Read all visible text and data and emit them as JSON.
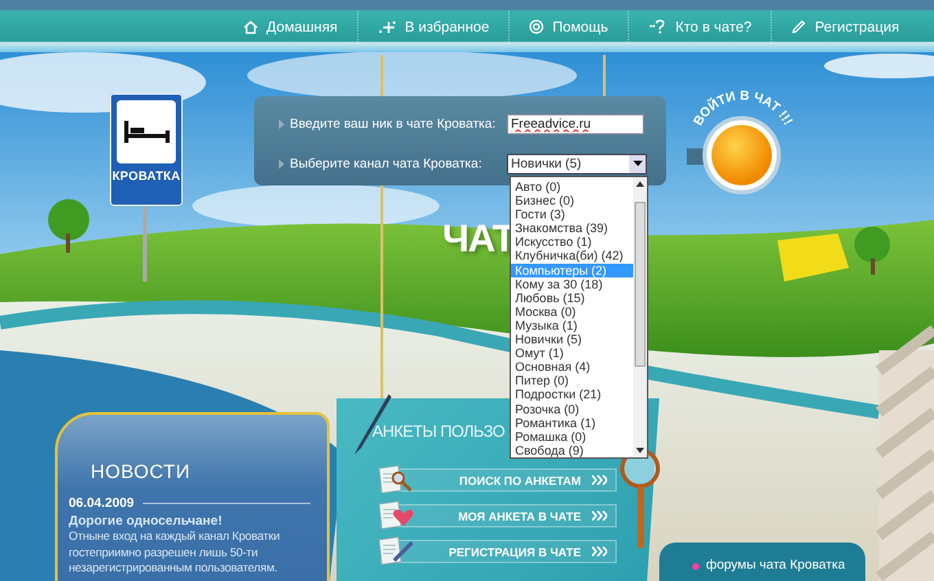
{
  "nav": [
    {
      "kind": "home",
      "label": "Домашняя"
    },
    {
      "kind": "favorite",
      "label": "В избранное"
    },
    {
      "kind": "help",
      "label": "Помощь"
    },
    {
      "kind": "who",
      "label": "Кто в чате?"
    },
    {
      "kind": "register",
      "label": "Регистрация"
    }
  ],
  "sign": {
    "label": "КРОВАТКА"
  },
  "login": {
    "nick_label": "Введите ваш ник в чате Кроватка:",
    "nick_value": "Freeadvice.ru",
    "channel_label": "Выберите канал чата Кроватка:",
    "channel_value": "Новички (5)",
    "enter_label": "ВОЙТИ В ЧАТ !!!"
  },
  "channel_list": [
    {
      "label": "Авто (0)",
      "selected": false
    },
    {
      "label": "Бизнес (0)",
      "selected": false
    },
    {
      "label": "Гости (3)",
      "selected": false
    },
    {
      "label": "Знакомства (39)",
      "selected": false
    },
    {
      "label": "Искусство (1)",
      "selected": false
    },
    {
      "label": "Клубничка(би) (42)",
      "selected": false
    },
    {
      "label": "Компьютеры (2)",
      "selected": true
    },
    {
      "label": "Кому за 30 (18)",
      "selected": false
    },
    {
      "label": "Любовь (15)",
      "selected": false
    },
    {
      "label": "Москва (0)",
      "selected": false
    },
    {
      "label": "Музыка (1)",
      "selected": false
    },
    {
      "label": "Новички (5)",
      "selected": false
    },
    {
      "label": "Омут (1)",
      "selected": false
    },
    {
      "label": "Основная (4)",
      "selected": false
    },
    {
      "label": "Питер (0)",
      "selected": false
    },
    {
      "label": "Подростки (21)",
      "selected": false
    },
    {
      "label": "Розочка (0)",
      "selected": false
    },
    {
      "label": "Романтика (1)",
      "selected": false
    },
    {
      "label": "Ромашка (0)",
      "selected": false
    },
    {
      "label": "Свобода (9)",
      "selected": false
    }
  ],
  "hero_title": "ЧАТ",
  "news": {
    "title": "НОВОСТИ",
    "date": "06.04.2009",
    "headline": "Дорогие односельчане!",
    "text": "Отныне вход на каждый канал Кроватки гостеприимно разрешен лишь 50-ти незарегистрированным пользователям."
  },
  "profiles": {
    "title": "АНКЕТЫ ПОЛЬЗО",
    "buttons": [
      {
        "kind": "search",
        "label": "ПОИСК ПО АНКЕТАМ"
      },
      {
        "kind": "heart",
        "label": "МОЯ АНКЕТА В ЧАТЕ"
      },
      {
        "kind": "pen",
        "label": "РЕГИСТРАЦИЯ В ЧАТЕ"
      }
    ]
  },
  "forum_link": "форумы чата Кроватка"
}
